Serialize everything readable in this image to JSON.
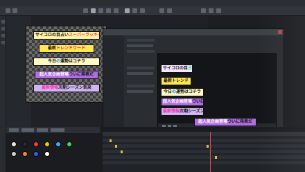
{
  "telops_canvas": [
    {
      "parts": [
        {
          "text": "サイコロの目占い",
          "color": "#111111"
        },
        {
          "text": "スーパーラッキー",
          "color": "#ff3b3b"
        }
      ],
      "bg": "#fff3a6"
    },
    {
      "parts": [
        {
          "text": "最新",
          "color": "#111111"
        },
        {
          "text": "トレンドワード",
          "color": "#e0198c"
        }
      ],
      "bg": "#ffe84d"
    },
    {
      "parts": [
        {
          "text": "今日",
          "color": "#111111"
        },
        {
          "text": "の",
          "color": "#1a7fe0"
        },
        {
          "text": "運勢",
          "color": "#111111"
        },
        {
          "text": "はコチラ",
          "color": "#111111"
        }
      ],
      "bg": "#fff9c4"
    },
    {
      "parts": [
        {
          "text": "超人気企画登場",
          "color": "#ffffff"
        },
        {
          "text": "ついに発表だ",
          "color": "#111111"
        }
      ],
      "bg": "#b06ee0"
    },
    {
      "parts": [
        {
          "text": "最新情報",
          "color": "#ff2bb4"
        },
        {
          "text": "次期シーズン到来",
          "color": "#111111"
        }
      ],
      "bg": "#cfb6f0"
    }
  ],
  "telops_preview": [
    {
      "parts": [
        {
          "text": "サイコロの目",
          "color": "#111111"
        },
        {
          "text": "占い",
          "color": "#2ed67a"
        }
      ],
      "bg": "#f3e6ff"
    },
    {
      "parts": [
        {
          "text": "最新トレンド",
          "color": "#111111"
        }
      ],
      "bg": "#ffe84d"
    },
    {
      "parts": [
        {
          "text": "今日",
          "color": "#111111"
        },
        {
          "text": "の",
          "color": "#1a7fe0"
        },
        {
          "text": "運勢はコチラ",
          "color": "#111111"
        }
      ],
      "bg": "#fff9c4"
    },
    {
      "parts": [
        {
          "text": "超人気企画登場",
          "color": "#ffffff"
        },
        {
          "text": "ついに発表だ",
          "color": "#111111"
        }
      ],
      "bg": "#b06ee0"
    },
    {
      "parts": [
        {
          "text": "最新情報",
          "color": "#ff2bb4"
        },
        {
          "text": "次期シーズン到来",
          "color": "#111111"
        }
      ],
      "bg": "#cfb6f0"
    },
    {
      "parts": [
        {
          "text": "超人気企画登場",
          "color": "#ffffff"
        },
        {
          "text": "ついに発表だ",
          "color": "#111111"
        }
      ],
      "bg": "#b06ee0"
    }
  ],
  "ball_colors": [
    "#e8e8e8",
    "#2a2a2a",
    "#ff3a3a",
    "#f0c419",
    "#3ab0ff",
    "#50d060",
    "#d0d0d0",
    "#ff8a1a",
    "#2a60ff",
    "#ffffff"
  ],
  "colors": {
    "playhead": "#e84a4a",
    "keyframe": "#d8c04a"
  }
}
